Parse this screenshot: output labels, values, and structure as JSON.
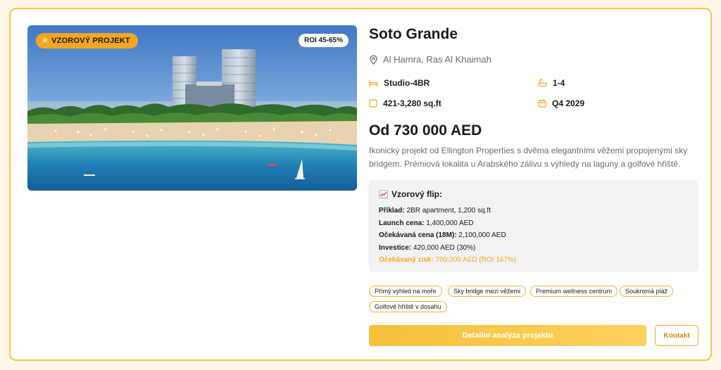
{
  "colors": {
    "accent": "#f5a623",
    "border": "#f5c250",
    "muted_text": "#6b6b6b",
    "panel_bg": "#f2f2f2"
  },
  "image": {
    "badge_label": "VZOROVÝ PROJEKT",
    "badge_icon": "star-icon",
    "roi_badge": "ROI 45-65%"
  },
  "project": {
    "title": "Soto Grande",
    "location": "Al Hamra, Ras Al Khaimah",
    "location_icon": "map-pin-icon",
    "specs": {
      "units": "Studio-4BR",
      "units_icon": "bed-icon",
      "bathrooms": "1-4",
      "bathrooms_icon": "bathtub-icon",
      "area": "421-3,280 sq.ft",
      "area_icon": "area-square-icon",
      "completion": "Q4 2029",
      "completion_icon": "calendar-icon"
    },
    "price": "Od 730 000 AED",
    "description": "Ikonický projekt od Ellington Properties s dvěma elegantními věžemi propojenými sky bridgem. Prémiová lokalita u Arabského zálivu s výhledy na laguny a golfové hřiště."
  },
  "flip": {
    "title": "Vzorový flip:",
    "title_icon": "chart-increasing-icon",
    "rows": [
      {
        "label": "Příklad:",
        "value": "2BR apartment, 1,200 sq.ft"
      },
      {
        "label": "Launch cena:",
        "value": "1,400,000 AED"
      },
      {
        "label": "Očekávaná cena (18M):",
        "value": "2,100,000 AED"
      },
      {
        "label": "Investice:",
        "value": "420,000 AED (30%)"
      },
      {
        "label": "Očekávaný zisk:",
        "value": "700,000 AED (ROI 167%)"
      }
    ]
  },
  "tags": [
    "Přímý výhled na moře",
    "Sky bridge mezi věžemi",
    "Premium wellness centrum",
    "Soukromá pláž",
    "Golfové hřiště v dosahu"
  ],
  "actions": {
    "primary": "Detailní analýza projektu",
    "secondary": "Kontakt"
  }
}
